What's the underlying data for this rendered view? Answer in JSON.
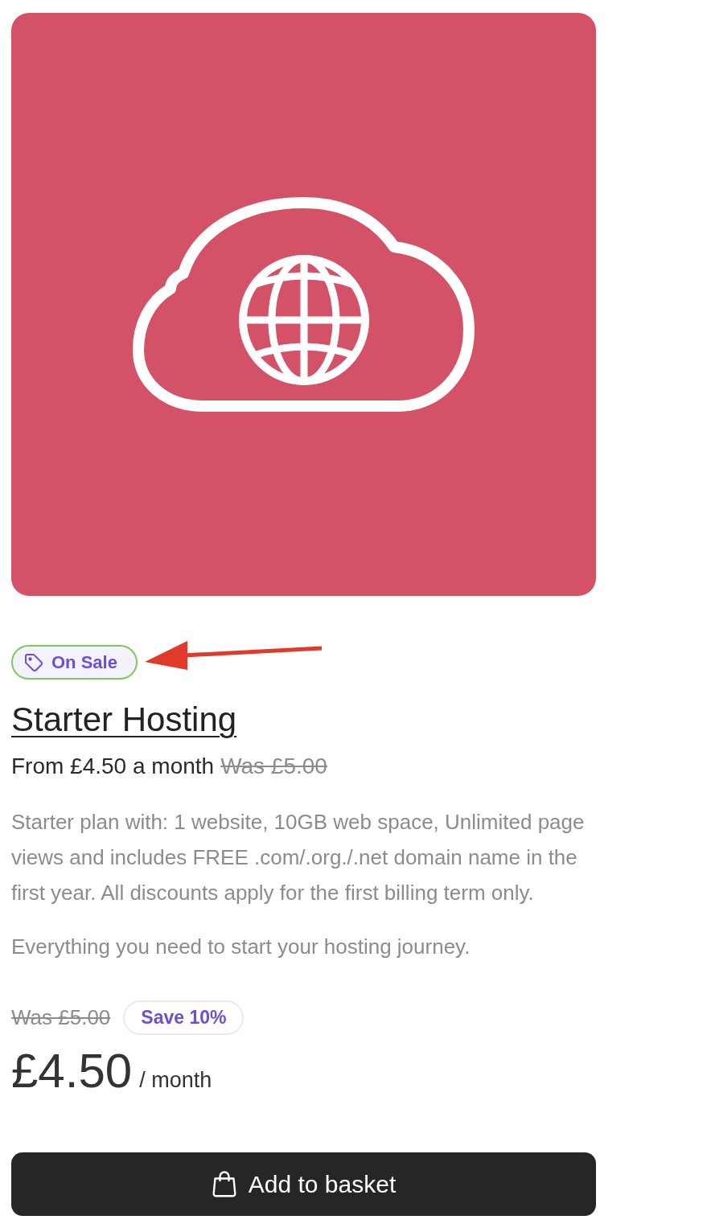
{
  "badge": {
    "label": "On Sale"
  },
  "product": {
    "title": "Starter Hosting",
    "summary": "From £4.50 a month",
    "summary_was": "Was £5.00",
    "description": [
      "Starter plan with: 1 website, 10GB web space, Unlimited page views and includes FREE .com/.org./.net domain name in the first year. All discounts apply for the first billing term only.",
      "Everything you need to start your hosting journey."
    ]
  },
  "pricing": {
    "was": "Was £5.00",
    "saving": "Save 10%",
    "price": "£4.50",
    "period": "/ month"
  },
  "button": {
    "label": "Add to basket"
  }
}
